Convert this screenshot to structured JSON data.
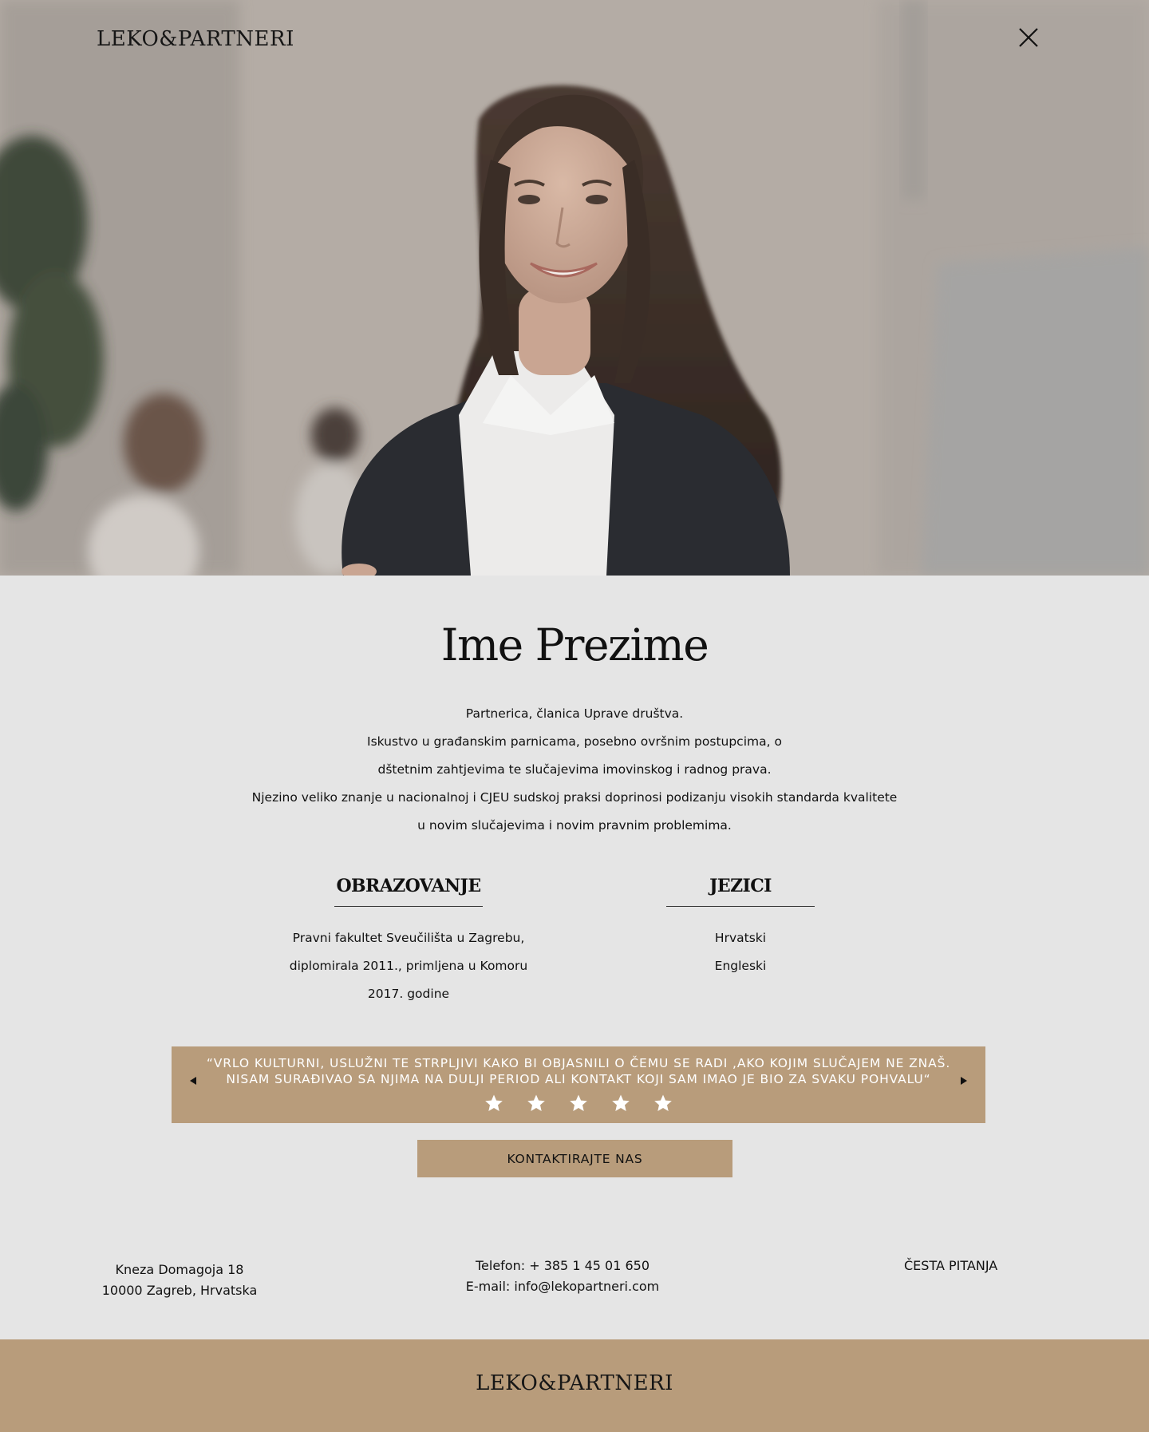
{
  "header": {
    "logo": "LEKO&PARTNERI",
    "close_icon": "close-icon"
  },
  "hero": {
    "photo": "portrait of smiling woman in dark blazer, blurred office background"
  },
  "profile": {
    "name": "Ime Prezime",
    "bio_lines": [
      "Partnerica, članica Uprave društva.",
      "Iskustvo u građanskim parnicama, posebno ovršnim postupcima, o",
      "dštetnim zahtjevima te slučajevima imovinskog i radnog prava.",
      "Njezino veliko znanje u nacionalnoj i CJEU sudskoj praksi doprinosi podizanju visokih standarda kvalitete",
      "u novim slučajevima i novim pravnim problemima."
    ],
    "education": {
      "heading": "OBRAZOVANJE",
      "lines": [
        "Pravni fakultet Sveučilišta u Zagrebu,",
        "diplomirala 2011., primljena u Komoru",
        "2017. godine"
      ]
    },
    "languages": {
      "heading": "JEZICI",
      "items": [
        "Hrvatski",
        "Engleski"
      ]
    }
  },
  "testimonial": {
    "quote_lines": [
      "“VRLO KULTURNI, USLUŽNI TE STRPLJIVI KAKO BI OBJASNILI O ČEMU SE RADI ,AKO KOJIM SLUČAJEM NE ZNAŠ.",
      "NISAM SURAĐIVAO SA NJIMA NA DULJI PERIOD ALI KONTAKT KOJI SAM IMAO JE BIO ZA SVAKU POHVALU“"
    ],
    "rating": 5,
    "prev_icon": "arrow-left-icon",
    "next_icon": "arrow-right-icon"
  },
  "cta": {
    "contact_label": "KONTAKTIRAJTE NAS"
  },
  "footer": {
    "address_line1": "Kneza Domagoja 18",
    "address_line2": "10000 Zagreb, Hrvatska",
    "phone": "Telefon: + 385 1 45 01 650",
    "email": "E-mail: info@lekopartneri.com",
    "faq_label": "ČESTA PITANJA",
    "logo": "LEKO&PARTNERI"
  },
  "colors": {
    "accent": "#b89c7b",
    "page_bg": "#e5e5e5",
    "text": "#111111"
  }
}
